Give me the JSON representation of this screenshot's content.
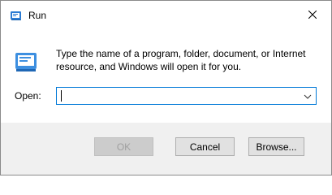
{
  "window": {
    "title": "Run",
    "icon": "run-icon",
    "close_icon": "close-icon"
  },
  "main": {
    "description": "Type the name of a program, folder, document, or Internet resource, and Windows will open it for you.",
    "open_label": "Open:",
    "open_value": "",
    "dropdown_icon": "chevron-down-icon"
  },
  "buttons": {
    "ok_label": "OK",
    "cancel_label": "Cancel",
    "browse_label": "Browse..."
  },
  "colors": {
    "accent": "#0078d7",
    "footer_bg": "#f0f0f0",
    "disabled_text": "#a0a0a0"
  }
}
